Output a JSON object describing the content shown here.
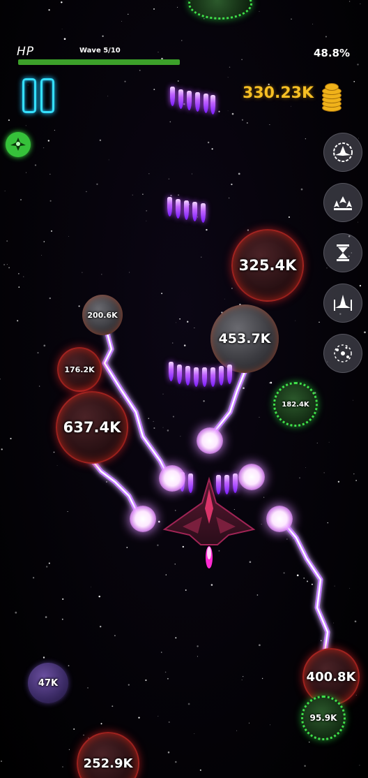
{
  "hud": {
    "hp_label": "HP",
    "wave_text": "Wave 5/10",
    "progress_text": "48.8%",
    "hp_fraction": 1.0,
    "coins_text": "330.23K"
  },
  "icons": {
    "pause": "pause-icon",
    "coins": "coin-stack-icon",
    "skill": "bomber-ship-skill-icon",
    "side_buttons": [
      "shield-ring-icon",
      "missile-barrage-icon",
      "hourglass-slow-icon",
      "fighter-formation-icon",
      "orbital-drones-icon"
    ]
  },
  "enemies": [
    {
      "hp": "325.4K",
      "kind": "red-rock"
    },
    {
      "hp": "200.6K",
      "kind": "gray-rock"
    },
    {
      "hp": "453.7K",
      "kind": "gray-rock"
    },
    {
      "hp": "176.2K",
      "kind": "red-rock"
    },
    {
      "hp": "182.4K",
      "kind": "green-virus"
    },
    {
      "hp": "637.4K",
      "kind": "red-rock"
    },
    {
      "hp": "47K",
      "kind": "purple-rock"
    },
    {
      "hp": "400.8K",
      "kind": "red-rock"
    },
    {
      "hp": "95.9K",
      "kind": "green-virus"
    },
    {
      "hp": "252.9K",
      "kind": "red-rock"
    }
  ],
  "colors": {
    "hp_bar": "#3ca02a",
    "pause": "#35e0ff",
    "coins": "#f6bf24",
    "lightning": "#c27bff",
    "enemy_glow_red": "#ff2a2a",
    "virus_green": "#3fe04a"
  }
}
